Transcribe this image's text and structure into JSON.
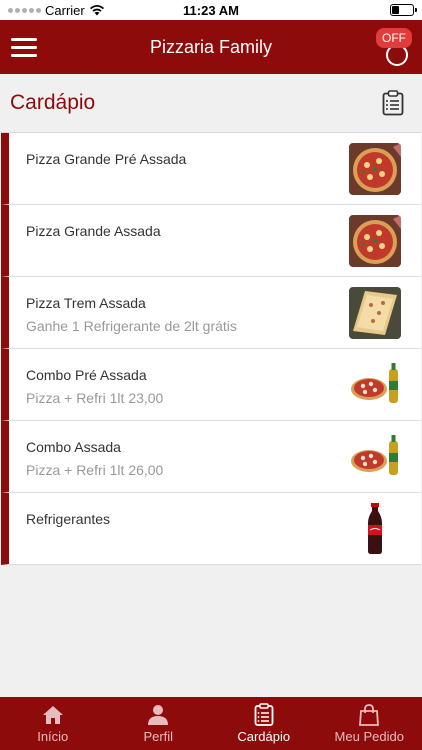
{
  "status_bar": {
    "carrier": "Carrier",
    "time": "11:23 AM"
  },
  "navbar": {
    "title": "Pizzaria Family",
    "store_status": "OFF"
  },
  "page": {
    "title": "Cardápio"
  },
  "menu_items": [
    {
      "name": "Pizza Grande Pré Assada",
      "description": "",
      "image": "pizza-photo-icon"
    },
    {
      "name": "Pizza Grande Assada",
      "description": "",
      "image": "pizza-photo-icon"
    },
    {
      "name": "Pizza Trem Assada",
      "description": "Ganhe 1 Refrigerante de 2lt grátis",
      "image": "long-pizza-photo-icon"
    },
    {
      "name": "Combo Pré Assada",
      "description": "Pizza + Refri 1lt 23,00",
      "image": "pizza-and-soda-icon"
    },
    {
      "name": "Combo Assada",
      "description": "Pizza + Refri 1lt 26,00",
      "image": "pizza-and-soda-icon"
    },
    {
      "name": "Refrigerantes",
      "description": "",
      "image": "cola-bottle-icon"
    }
  ],
  "tabs": [
    {
      "label": "Início",
      "icon": "home-icon",
      "active": false
    },
    {
      "label": "Perfil",
      "icon": "person-icon",
      "active": false
    },
    {
      "label": "Cardápio",
      "icon": "clipboard-icon",
      "active": true
    },
    {
      "label": "Meu Pedido",
      "icon": "shopping-bag-icon",
      "active": false
    }
  ],
  "colors": {
    "primary": "#8e0b0c",
    "badge": "#e23b3b",
    "background": "#f0f0f0"
  }
}
